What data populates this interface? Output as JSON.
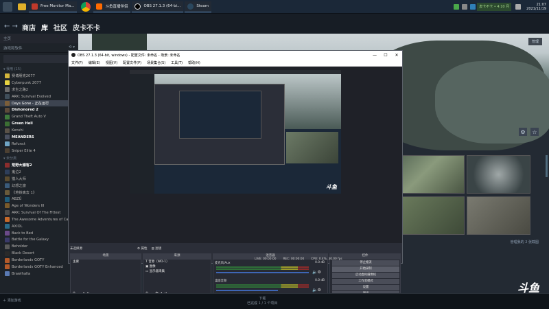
{
  "taskbar": {
    "apps": [
      {
        "label": "Free Monitor Ma...",
        "color": "#c0392b"
      },
      {
        "label": "",
        "color": "#e05a2b"
      },
      {
        "label": "斗鱼直播伴侣",
        "color": "#ff6a00"
      },
      {
        "label": "OBS 27.1.3 (64-bi...",
        "color": "#302e31"
      },
      {
        "label": "Steam",
        "color": "#1b2838"
      }
    ],
    "steam_mini": "皮卡不卡 • 4:10 月",
    "clock_time": "21:07",
    "clock_date": "2021/11/19"
  },
  "steam": {
    "nav": [
      "商店",
      "库",
      "社区",
      "皮卡不卡"
    ],
    "home": "主页",
    "filter": "游戏和软件",
    "favorites_label": "我用",
    "favorites_count": "(15)",
    "uncat_label": "未分类",
    "games_fav": [
      {
        "name": "赛博朋克2077",
        "color": "#d4b63c",
        "style": ""
      },
      {
        "name": "Cyberpunk 2077",
        "color": "#e7d341",
        "style": ""
      },
      {
        "name": "求生之路2",
        "color": "#6b6b6b",
        "style": ""
      },
      {
        "name": "ARK: Survival Evolved",
        "color": "#3f4e5a",
        "style": ""
      },
      {
        "name": "Days Gone - 正在运行",
        "color": "#7b5e3a",
        "style": "selected"
      },
      {
        "name": "Dishonored 2",
        "color": "#5d4a3a",
        "style": "bold"
      },
      {
        "name": "Grand Theft Auto V",
        "color": "#3e7a3c",
        "style": ""
      },
      {
        "name": "Green Hell",
        "color": "#3b6e33",
        "style": "bold"
      },
      {
        "name": "Kenshi",
        "color": "#5a5248",
        "style": ""
      },
      {
        "name": "MEANDERS",
        "color": "#4a5060",
        "style": "bold"
      },
      {
        "name": "Refunct",
        "color": "#6fa4c4",
        "style": ""
      },
      {
        "name": "Sniper Elite 4",
        "color": "#4c4032",
        "style": ""
      }
    ],
    "games_uncat": [
      {
        "name": "荒野大镖客2",
        "color": "#8c2d2d",
        "style": "bold"
      },
      {
        "name": "鬼泣2",
        "color": "#2e3e5a",
        "style": ""
      },
      {
        "name": "猎人大师",
        "color": "#5a4a2e",
        "style": ""
      },
      {
        "name": "幻想之旅",
        "color": "#3a5a7a",
        "style": ""
      },
      {
        "name": "《地铁离去 1》",
        "color": "#6a5a3a",
        "style": ""
      },
      {
        "name": "ABZÛ",
        "color": "#1f5c7a",
        "style": ""
      },
      {
        "name": "Age of Wonders III",
        "color": "#7a5a2a",
        "style": ""
      },
      {
        "name": "ARK: Survival Of The Fittest",
        "color": "#4a4a4a",
        "style": ""
      },
      {
        "name": "The Awesome Adventures of Ca...",
        "color": "#c7692a",
        "style": ""
      },
      {
        "name": "AXIOL",
        "color": "#2a6a8a",
        "style": ""
      },
      {
        "name": "Back to Bed",
        "color": "#6b4a8a",
        "style": ""
      },
      {
        "name": "Battle for the Galaxy",
        "color": "#3a3a6a",
        "style": ""
      },
      {
        "name": "Beholder",
        "color": "#5a5a5a",
        "style": ""
      },
      {
        "name": "Black Desert",
        "color": "#2a2a2a",
        "style": ""
      },
      {
        "name": "Borderlands GOTY",
        "color": "#b45a2a",
        "style": ""
      },
      {
        "name": "Borderlands GOTY Enhanced",
        "color": "#b45a2a",
        "style": ""
      },
      {
        "name": "Brawlhalla",
        "color": "#5a7ab4",
        "style": ""
      }
    ],
    "hero_button": "管理",
    "screenshots_label": "管理我的 2 张截图",
    "add_game": "添加游戏",
    "downloads_title": "下载",
    "downloads_sub": "已完成 1 / 1 个项目",
    "brand": "斗鱼"
  },
  "obs": {
    "title": "OBS 27.1.3 (64-bit, windows) - 配置文件: 未命名 - 场景: 未命名",
    "menu": [
      "文件(F)",
      "编辑(E)",
      "视图(V)",
      "配置文件(P)",
      "场景集合(S)",
      "工具(T)",
      "帮助(H)"
    ],
    "scene_tab": "未选择源",
    "props_label": "属性",
    "filters_label": "滤镜",
    "dock_headers": [
      "场景",
      "来源",
      "混音器",
      "控件"
    ],
    "scenes": [
      "主要"
    ],
    "sources": [
      "音源（WD-1）",
      "图像",
      "显示器采集"
    ],
    "mixer": [
      {
        "name": "麦克风/Aux",
        "db": "0.0 dB"
      },
      {
        "name": "桌面音频",
        "db": "0.0 dB"
      }
    ],
    "controls": [
      "停止推流",
      "开始录制",
      "启动虚拟摄像机",
      "工作室模式",
      "设置",
      "退出"
    ],
    "status": [
      "LIVE: 00:00:00",
      "REC: 00:00:00",
      "CPU: 0.4%, 30.00 fps"
    ]
  }
}
